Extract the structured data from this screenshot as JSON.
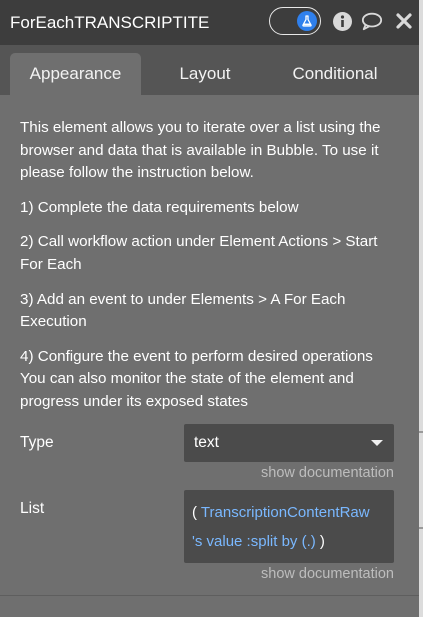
{
  "header": {
    "title": "ForEachTRANSCRIPTITEM",
    "icons": {
      "toggle": "flask-icon",
      "info": "info-icon",
      "comment": "comment-icon",
      "close": "close-icon"
    }
  },
  "tabs": [
    {
      "label": "Appearance",
      "active": true
    },
    {
      "label": "Layout",
      "active": false
    },
    {
      "label": "Conditional",
      "active": false
    }
  ],
  "description": [
    "This element allows you to iterate over a list using the browser and data that is available in Bubble. To use it please follow the instruction below.",
    "1) Complete the data requirements below",
    "2) Call workflow action under Element Actions > Start For Each",
    "3) Add an event to under Elements > A For Each Execution",
    "4) Configure the event to perform desired operations You can also monitor the state of the element and progress under its exposed states"
  ],
  "fields": {
    "type": {
      "label": "Type",
      "value": "text",
      "doc_link": "show documentation"
    },
    "list": {
      "label": "List",
      "open_paren": "(",
      "expr_line1": "TranscriptionContentRaw",
      "expr_line2": "'s value :split by (.)",
      "close_paren": ")",
      "doc_link": "show documentation"
    }
  },
  "colors": {
    "header_bg": "#3d3d3d",
    "tabs_bg": "#555555",
    "panel_bg": "#6f6f6f",
    "input_bg": "#4b4b4b",
    "accent": "#2f80ed",
    "expression": "#7ab8ff"
  }
}
